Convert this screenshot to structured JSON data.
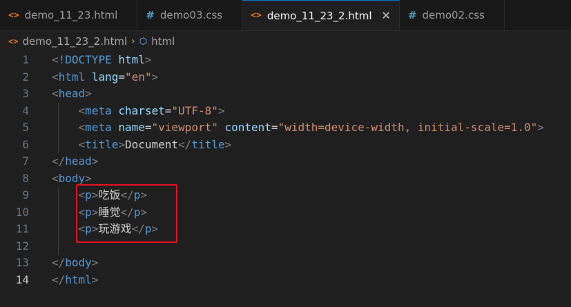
{
  "tabs": [
    {
      "icon": "html-file-icon",
      "label": "demo_11_23.html",
      "active": false
    },
    {
      "icon": "css-file-icon",
      "label": "demo03.css",
      "active": false
    },
    {
      "icon": "html-file-icon",
      "label": "demo_11_23_2.html",
      "active": true
    },
    {
      "icon": "css-file-icon",
      "label": "demo02.css",
      "active": false
    }
  ],
  "breadcrumb": {
    "file": "demo_11_23_2.html",
    "symbol": "html"
  },
  "current_line": 14,
  "colors": {
    "tag": "#569cd6",
    "bracket": "#808080",
    "attr": "#9cdcfe",
    "string": "#ce9178",
    "text": "#d4d4d4",
    "highlight_box": "#e81123"
  },
  "lines": [
    {
      "n": "1",
      "tokens": [
        [
          "br",
          "<"
        ],
        [
          "tag",
          "!DOCTYPE"
        ],
        [
          "txt",
          " "
        ],
        [
          "attr",
          "html"
        ],
        [
          "br",
          ">"
        ]
      ]
    },
    {
      "n": "2",
      "tokens": [
        [
          "br",
          "<"
        ],
        [
          "tag",
          "html"
        ],
        [
          "txt",
          " "
        ],
        [
          "attr",
          "lang"
        ],
        [
          "txt",
          "="
        ],
        [
          "str",
          "\"en\""
        ],
        [
          "br",
          ">"
        ]
      ]
    },
    {
      "n": "3",
      "tokens": [
        [
          "br",
          "<"
        ],
        [
          "tag",
          "head"
        ],
        [
          "br",
          ">"
        ]
      ]
    },
    {
      "n": "4",
      "tokens": [
        [
          "txt",
          "    "
        ],
        [
          "br",
          "<"
        ],
        [
          "tag",
          "meta"
        ],
        [
          "txt",
          " "
        ],
        [
          "attr",
          "charset"
        ],
        [
          "txt",
          "="
        ],
        [
          "str",
          "\"UTF-8\""
        ],
        [
          "br",
          ">"
        ]
      ]
    },
    {
      "n": "5",
      "tokens": [
        [
          "txt",
          "    "
        ],
        [
          "br",
          "<"
        ],
        [
          "tag",
          "meta"
        ],
        [
          "txt",
          " "
        ],
        [
          "attr",
          "name"
        ],
        [
          "txt",
          "="
        ],
        [
          "str",
          "\"viewport\""
        ],
        [
          "txt",
          " "
        ],
        [
          "attr",
          "content"
        ],
        [
          "txt",
          "="
        ],
        [
          "str",
          "\"width=device-width, initial-scale=1.0\""
        ],
        [
          "br",
          ">"
        ]
      ]
    },
    {
      "n": "6",
      "tokens": [
        [
          "txt",
          "    "
        ],
        [
          "br",
          "<"
        ],
        [
          "tag",
          "title"
        ],
        [
          "br",
          ">"
        ],
        [
          "txt",
          "Document"
        ],
        [
          "br",
          "</"
        ],
        [
          "tag",
          "title"
        ],
        [
          "br",
          ">"
        ]
      ]
    },
    {
      "n": "7",
      "tokens": [
        [
          "br",
          "</"
        ],
        [
          "tag",
          "head"
        ],
        [
          "br",
          ">"
        ]
      ]
    },
    {
      "n": "8",
      "tokens": [
        [
          "br",
          "<"
        ],
        [
          "tag",
          "body"
        ],
        [
          "br",
          ">"
        ]
      ]
    },
    {
      "n": "9",
      "tokens": [
        [
          "txt",
          "    "
        ],
        [
          "br",
          "<"
        ],
        [
          "tag",
          "p"
        ],
        [
          "br",
          ">"
        ],
        [
          "txt",
          "吃饭"
        ],
        [
          "br",
          "</"
        ],
        [
          "tag",
          "p"
        ],
        [
          "br",
          ">"
        ]
      ]
    },
    {
      "n": "10",
      "tokens": [
        [
          "txt",
          "    "
        ],
        [
          "br",
          "<"
        ],
        [
          "tag",
          "p"
        ],
        [
          "br",
          ">"
        ],
        [
          "txt",
          "睡觉"
        ],
        [
          "br",
          "</"
        ],
        [
          "tag",
          "p"
        ],
        [
          "br",
          ">"
        ]
      ]
    },
    {
      "n": "11",
      "tokens": [
        [
          "txt",
          "    "
        ],
        [
          "br",
          "<"
        ],
        [
          "tag",
          "p"
        ],
        [
          "br",
          ">"
        ],
        [
          "txt",
          "玩游戏"
        ],
        [
          "br",
          "</"
        ],
        [
          "tag",
          "p"
        ],
        [
          "br",
          ">"
        ]
      ]
    },
    {
      "n": "12",
      "tokens": []
    },
    {
      "n": "13",
      "tokens": [
        [
          "br",
          "</"
        ],
        [
          "tag",
          "body"
        ],
        [
          "br",
          ">"
        ]
      ]
    },
    {
      "n": "14",
      "tokens": [
        [
          "br",
          "</"
        ],
        [
          "tag",
          "html"
        ],
        [
          "br",
          ">"
        ]
      ]
    }
  ]
}
